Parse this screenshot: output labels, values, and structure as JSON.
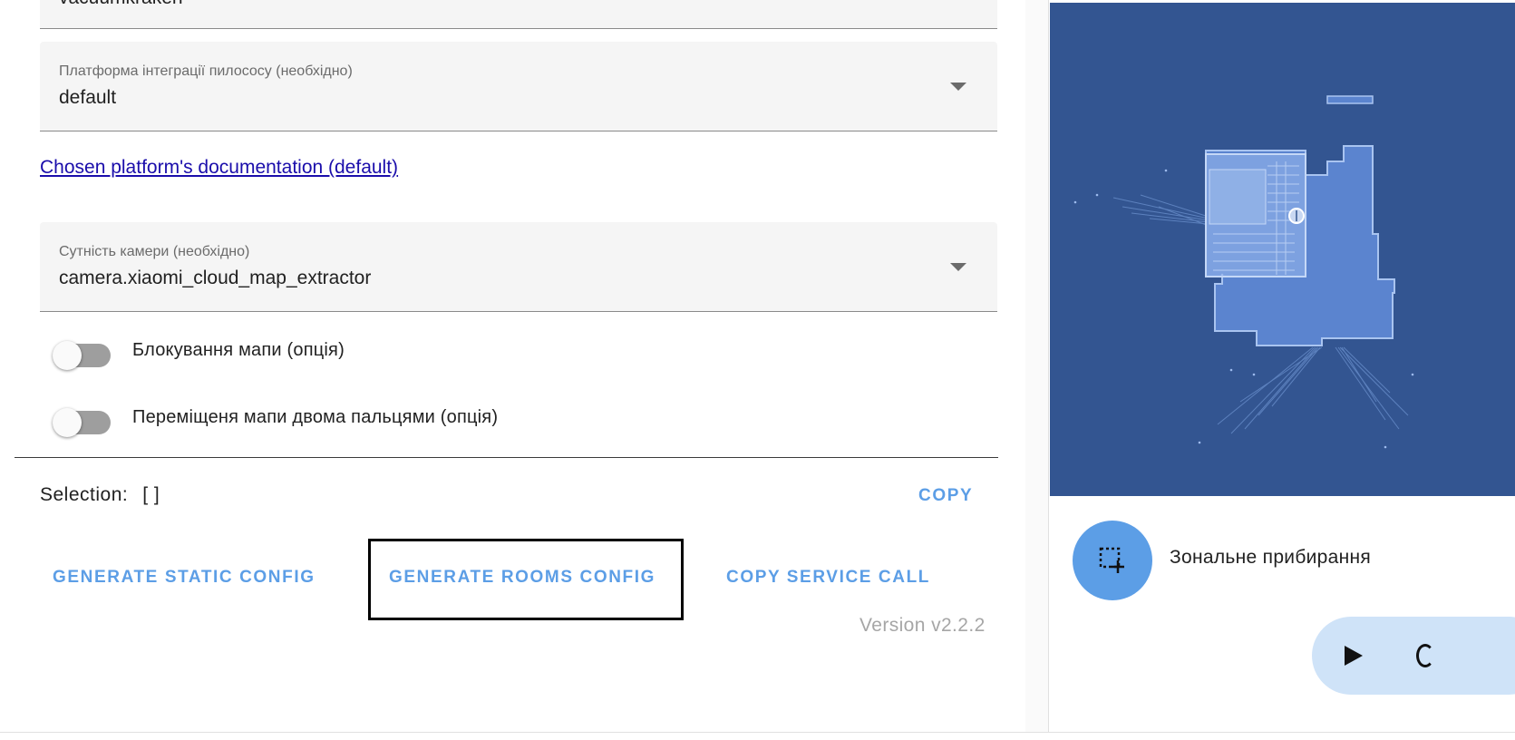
{
  "form": {
    "top_field_value": "vacuumkraken",
    "platform": {
      "label": "Платформа інтеграції пилососу (необхідно)",
      "value": "default"
    },
    "doc_link": "Chosen platform's documentation (default)",
    "camera": {
      "label": "Сутність камери (необхідно)",
      "value": "camera.xiaomi_cloud_map_extractor"
    },
    "toggles": [
      {
        "label": "Блокування мапи (опція)",
        "on": false
      },
      {
        "label": "Переміщеня мапи двома пальцями (опція)",
        "on": false
      }
    ]
  },
  "selection": {
    "label": "Selection:",
    "value": "[ ]",
    "copy_label": "COPY"
  },
  "actions": {
    "static_config": "GENERATE STATIC CONFIG",
    "rooms_config": "GENERATE ROOMS CONFIG",
    "copy_service_call": "COPY SERVICE CALL"
  },
  "version": "Version v2.2.2",
  "card": {
    "zone_label": "Зональне прибирання",
    "zone_icon": "zone-select-add-icon",
    "play_icon": "play-icon"
  },
  "colors": {
    "accent": "#5c9ee6",
    "map_background": "#335591",
    "map_floor": "#5b84cf",
    "pill_background": "#cfe3f8"
  }
}
